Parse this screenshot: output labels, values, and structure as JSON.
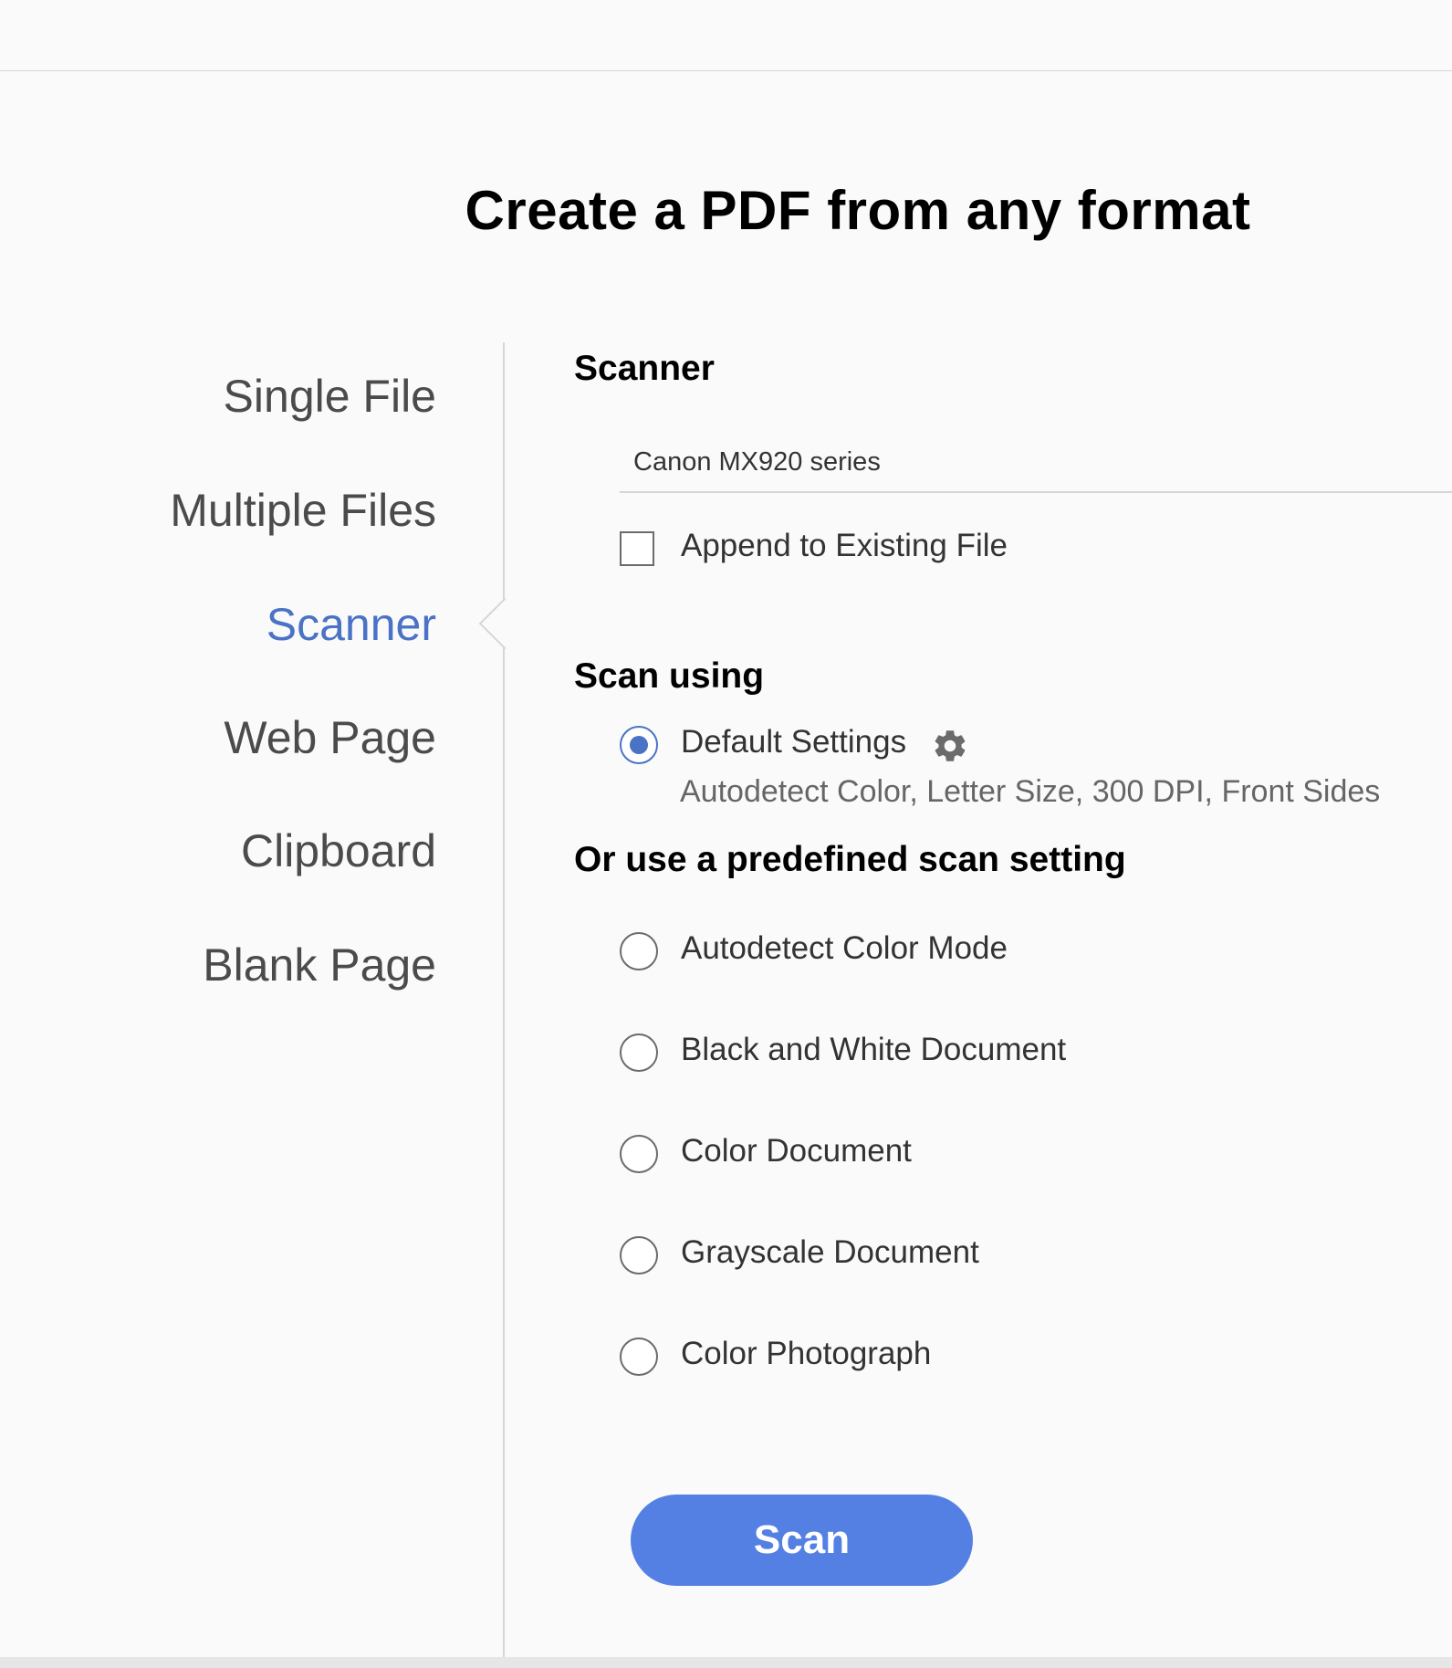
{
  "page_title": "Create a PDF from any format",
  "nav": {
    "items": [
      {
        "label": "Single File"
      },
      {
        "label": "Multiple Files"
      },
      {
        "label": "Scanner",
        "active": true
      },
      {
        "label": "Web Page"
      },
      {
        "label": "Clipboard"
      },
      {
        "label": "Blank Page"
      }
    ]
  },
  "scanner": {
    "heading": "Scanner",
    "selected_device": "Canon MX920 series",
    "append_label": "Append to Existing File",
    "append_checked": false
  },
  "scan_using": {
    "heading": "Scan using",
    "default_label": "Default Settings",
    "default_checked": true,
    "default_description": "Autodetect Color, Letter Size, 300 DPI, Front Sides",
    "settings_icon": "gear-icon"
  },
  "predefined": {
    "heading": "Or use a predefined scan setting",
    "options": [
      {
        "label": "Autodetect Color Mode"
      },
      {
        "label": "Black and White Document"
      },
      {
        "label": "Color Document"
      },
      {
        "label": "Grayscale Document"
      },
      {
        "label": "Color Photograph"
      }
    ]
  },
  "scan_button": {
    "label": "Scan"
  },
  "colors": {
    "accent": "#4a73c6",
    "button": "#5580e3",
    "background": "#fafafa"
  }
}
